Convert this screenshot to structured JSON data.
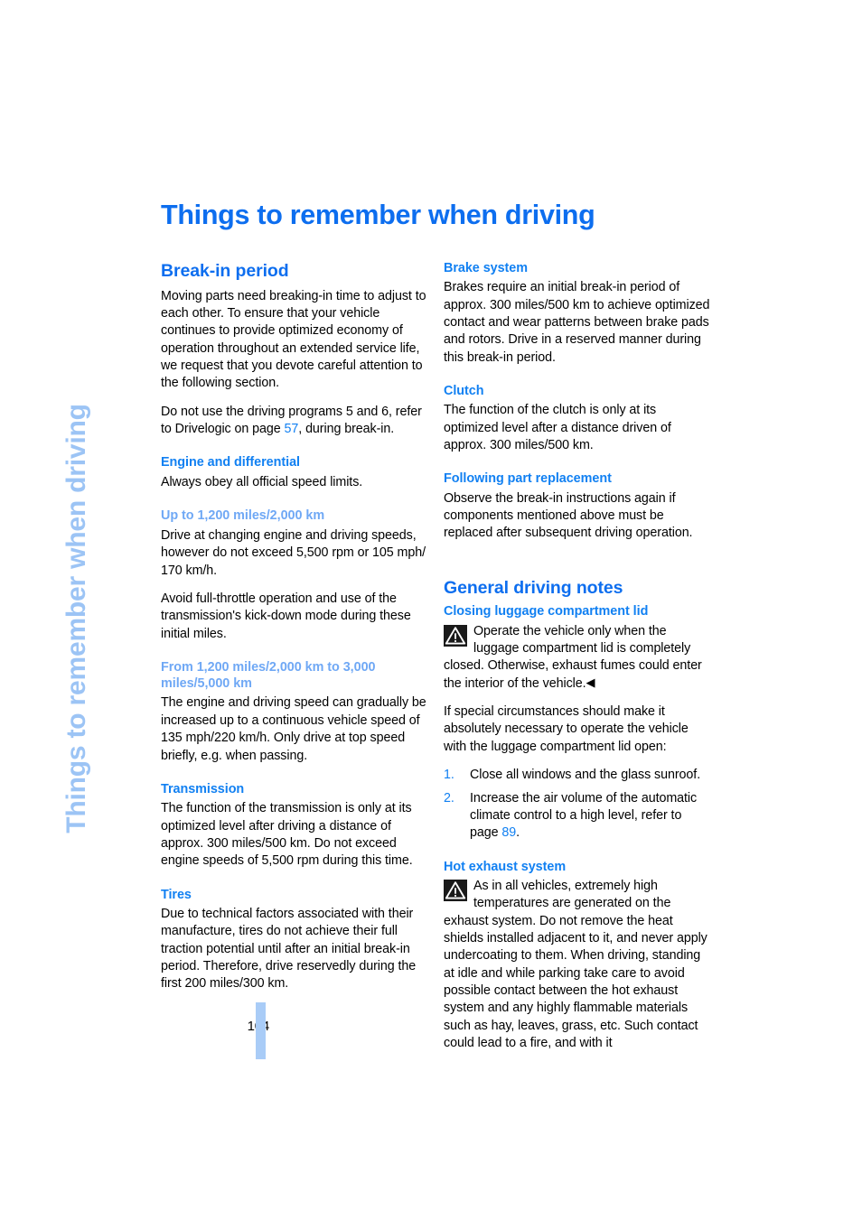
{
  "chapter_tab": "Things to remember when driving",
  "page_title": "Things to remember when driving",
  "folio": {
    "page_number": "104"
  },
  "colors": {
    "heading_blue": "#0D6EEF",
    "subheading_blue": "#1180F2",
    "light_blue": "#6FA8F5",
    "tab_blue": "#9CC4F5",
    "rule_blue": "#A9CCF7"
  },
  "left_column": {
    "section_title": "Break-in period",
    "intro_paragraph": "Moving parts need breaking-in time to adjust to each other. To ensure that your vehicle continues to provide optimized economy of operation throughout an extended service life, we request that you devote careful attention to the following section.",
    "drivelogic_lead": "Do not use the driving programs 5 and 6, refer to Drivelogic on page ",
    "drivelogic_page_ref": "57",
    "drivelogic_tail": ", during break-in.",
    "engine_heading": "Engine and differential",
    "engine_paragraph": "Always obey all official speed limits.",
    "upto_heading": "Up to 1,200 miles/2,000 km",
    "upto_paragraph_1": "Drive at changing engine and driving speeds, however do not exceed 5,500 rpm or 105 mph/ 170 km/h.",
    "upto_paragraph_2": "Avoid full-throttle operation and use of the transmission's kick-down mode during these initial miles.",
    "from_heading": "From 1,200 miles/2,000 km to 3,000 miles/5,000 km",
    "from_paragraph": "The engine and driving speed can gradually be increased up to a continuous vehicle speed of 135 mph/220 km/h. Only drive at top speed briefly, e.g. when passing.",
    "transmission_heading": "Transmission",
    "transmission_paragraph": "The function of the transmission is only at its optimized level after driving a distance of approx. 300 miles/500 km. Do not exceed engine speeds of 5,500 rpm during this time.",
    "tires_heading": "Tires",
    "tires_paragraph": "Due to technical factors associated with their manufacture, tires do not achieve their full traction potential until after an initial break-in period. Therefore, drive reservedly during the first 200 miles/300 km."
  },
  "right_column": {
    "brake_heading": "Brake system",
    "brake_paragraph": "Brakes require an initial break-in period of approx. 300 miles/500 km to achieve optimized contact and wear patterns between brake pads and rotors. Drive in a reserved manner during this break-in period.",
    "clutch_heading": "Clutch",
    "clutch_paragraph": "The function of the clutch is only at its optimized level after a distance driven of approx. 300 miles/500 km.",
    "following_heading": "Following part replacement",
    "following_paragraph": "Observe the break-in instructions again if components mentioned above must be replaced after subsequent driving operation.",
    "section_title": "General driving notes",
    "luggage_heading": "Closing luggage compartment lid",
    "luggage_warning": "Operate the vehicle only when the luggage compartment lid is completely closed. Otherwise, exhaust fumes could enter the interior of the vehicle.",
    "luggage_warning_end_marker": "◀",
    "luggage_paragraph": "If special circumstances should make it absolutely necessary to operate the vehicle with the luggage compartment lid open:",
    "steps": [
      {
        "number": "1.",
        "text": "Close all windows and the glass sunroof.",
        "page_ref": null
      },
      {
        "number": "2.",
        "text": "Increase the air volume of the automatic climate control to a high level, refer to page ",
        "page_ref": "89",
        "text_tail": "."
      }
    ],
    "exhaust_heading": "Hot exhaust system",
    "exhaust_warning": "As in all vehicles, extremely high temperatures are generated on the exhaust system. Do not remove the heat shields installed adjacent to it, and never apply undercoating to them. When driving, standing at idle and while parking take care to avoid possible contact between the hot exhaust system and any highly flammable materials such as hay, leaves, grass, etc. Such contact could lead to a fire, and with it"
  },
  "icons": {
    "warning_triangle": "warning-triangle-icon"
  }
}
